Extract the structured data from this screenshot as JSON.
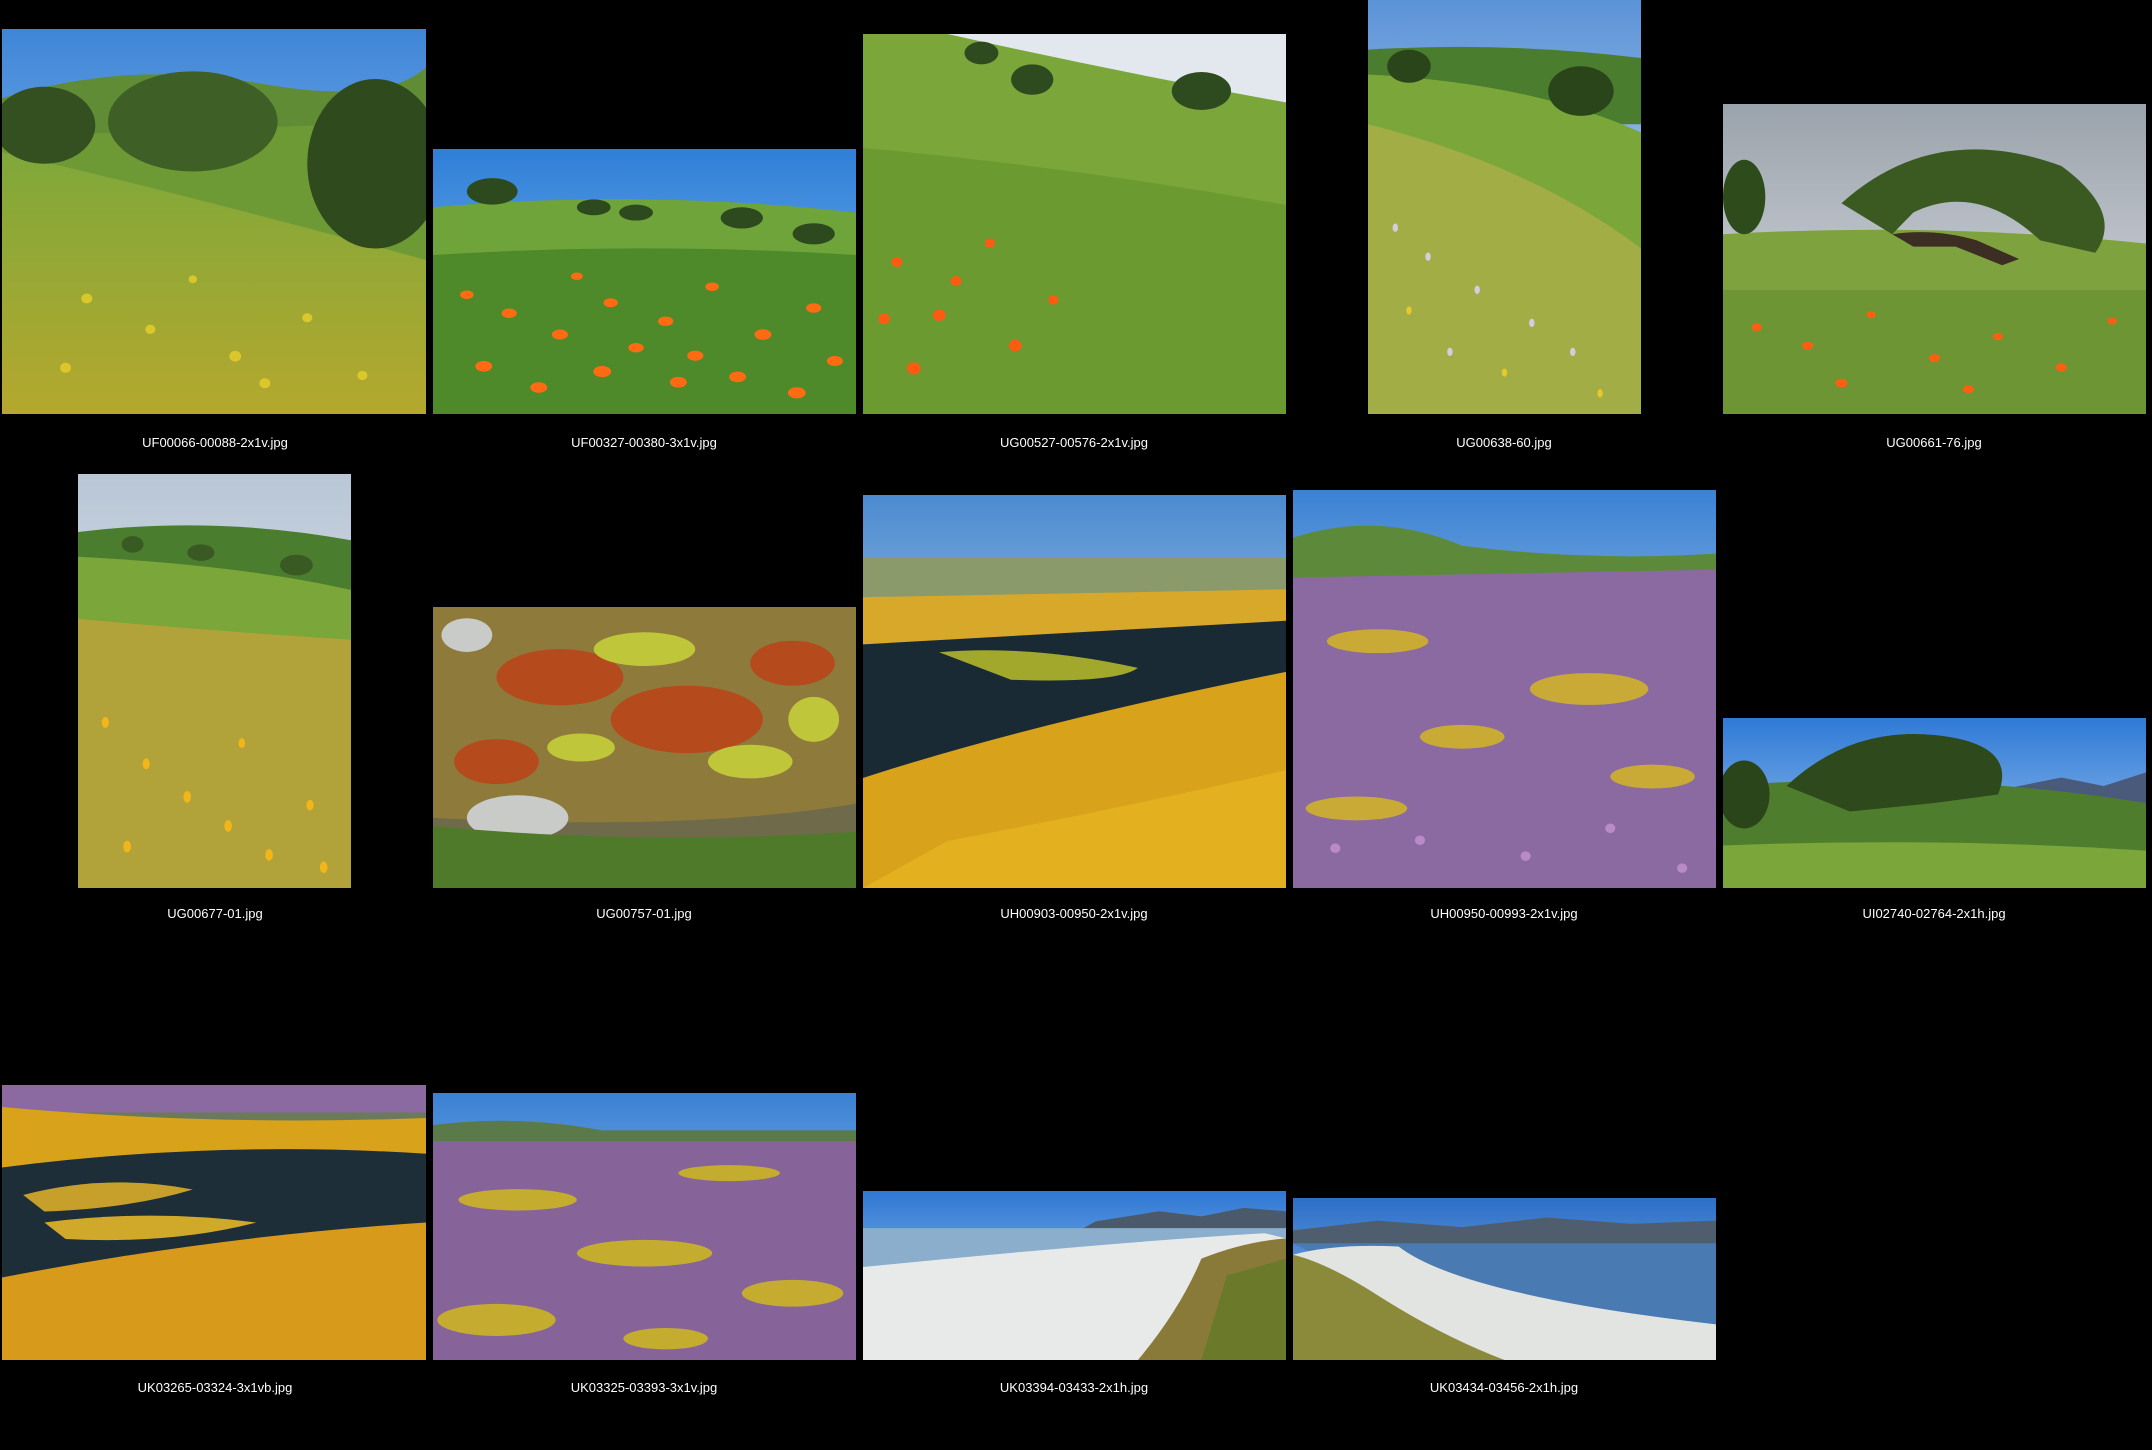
{
  "gallery": {
    "items": [
      {
        "filename": "UF00066-00088-2x1v.jpg",
        "scene": "meadow-oak-yellow"
      },
      {
        "filename": "UF00327-00380-3x1v.jpg",
        "scene": "poppy-field-oaks"
      },
      {
        "filename": "UG00527-00576-2x1v.jpg",
        "scene": "green-slope-poppies"
      },
      {
        "filename": "UG00638-60.jpg",
        "scene": "hillside-flowers-oak"
      },
      {
        "filename": "UG00661-76.jpg",
        "scene": "windswept-oak-poppies"
      },
      {
        "filename": "UG00677-01.jpg",
        "scene": "hillside-goldfields"
      },
      {
        "filename": "UG00757-01.jpg",
        "scene": "lichen-rock"
      },
      {
        "filename": "UH00903-00950-2x1v.jpg",
        "scene": "vernal-pool-goldfields"
      },
      {
        "filename": "UH00950-00993-2x1v.jpg",
        "scene": "owls-clover-field"
      },
      {
        "filename": "UI02740-02764-2x1h.jpg",
        "scene": "oak-hill-mountains"
      },
      {
        "filename": "UK03265-03324-3x1vb.jpg",
        "scene": "vernal-pool-close"
      },
      {
        "filename": "UK03325-03393-3x1v.jpg",
        "scene": "purple-yellow-plain"
      },
      {
        "filename": "UK03394-03433-2x1h.jpg",
        "scene": "salt-lake-shore"
      },
      {
        "filename": "UK03434-03456-2x1h.jpg",
        "scene": "salt-lake-reflection"
      }
    ]
  }
}
